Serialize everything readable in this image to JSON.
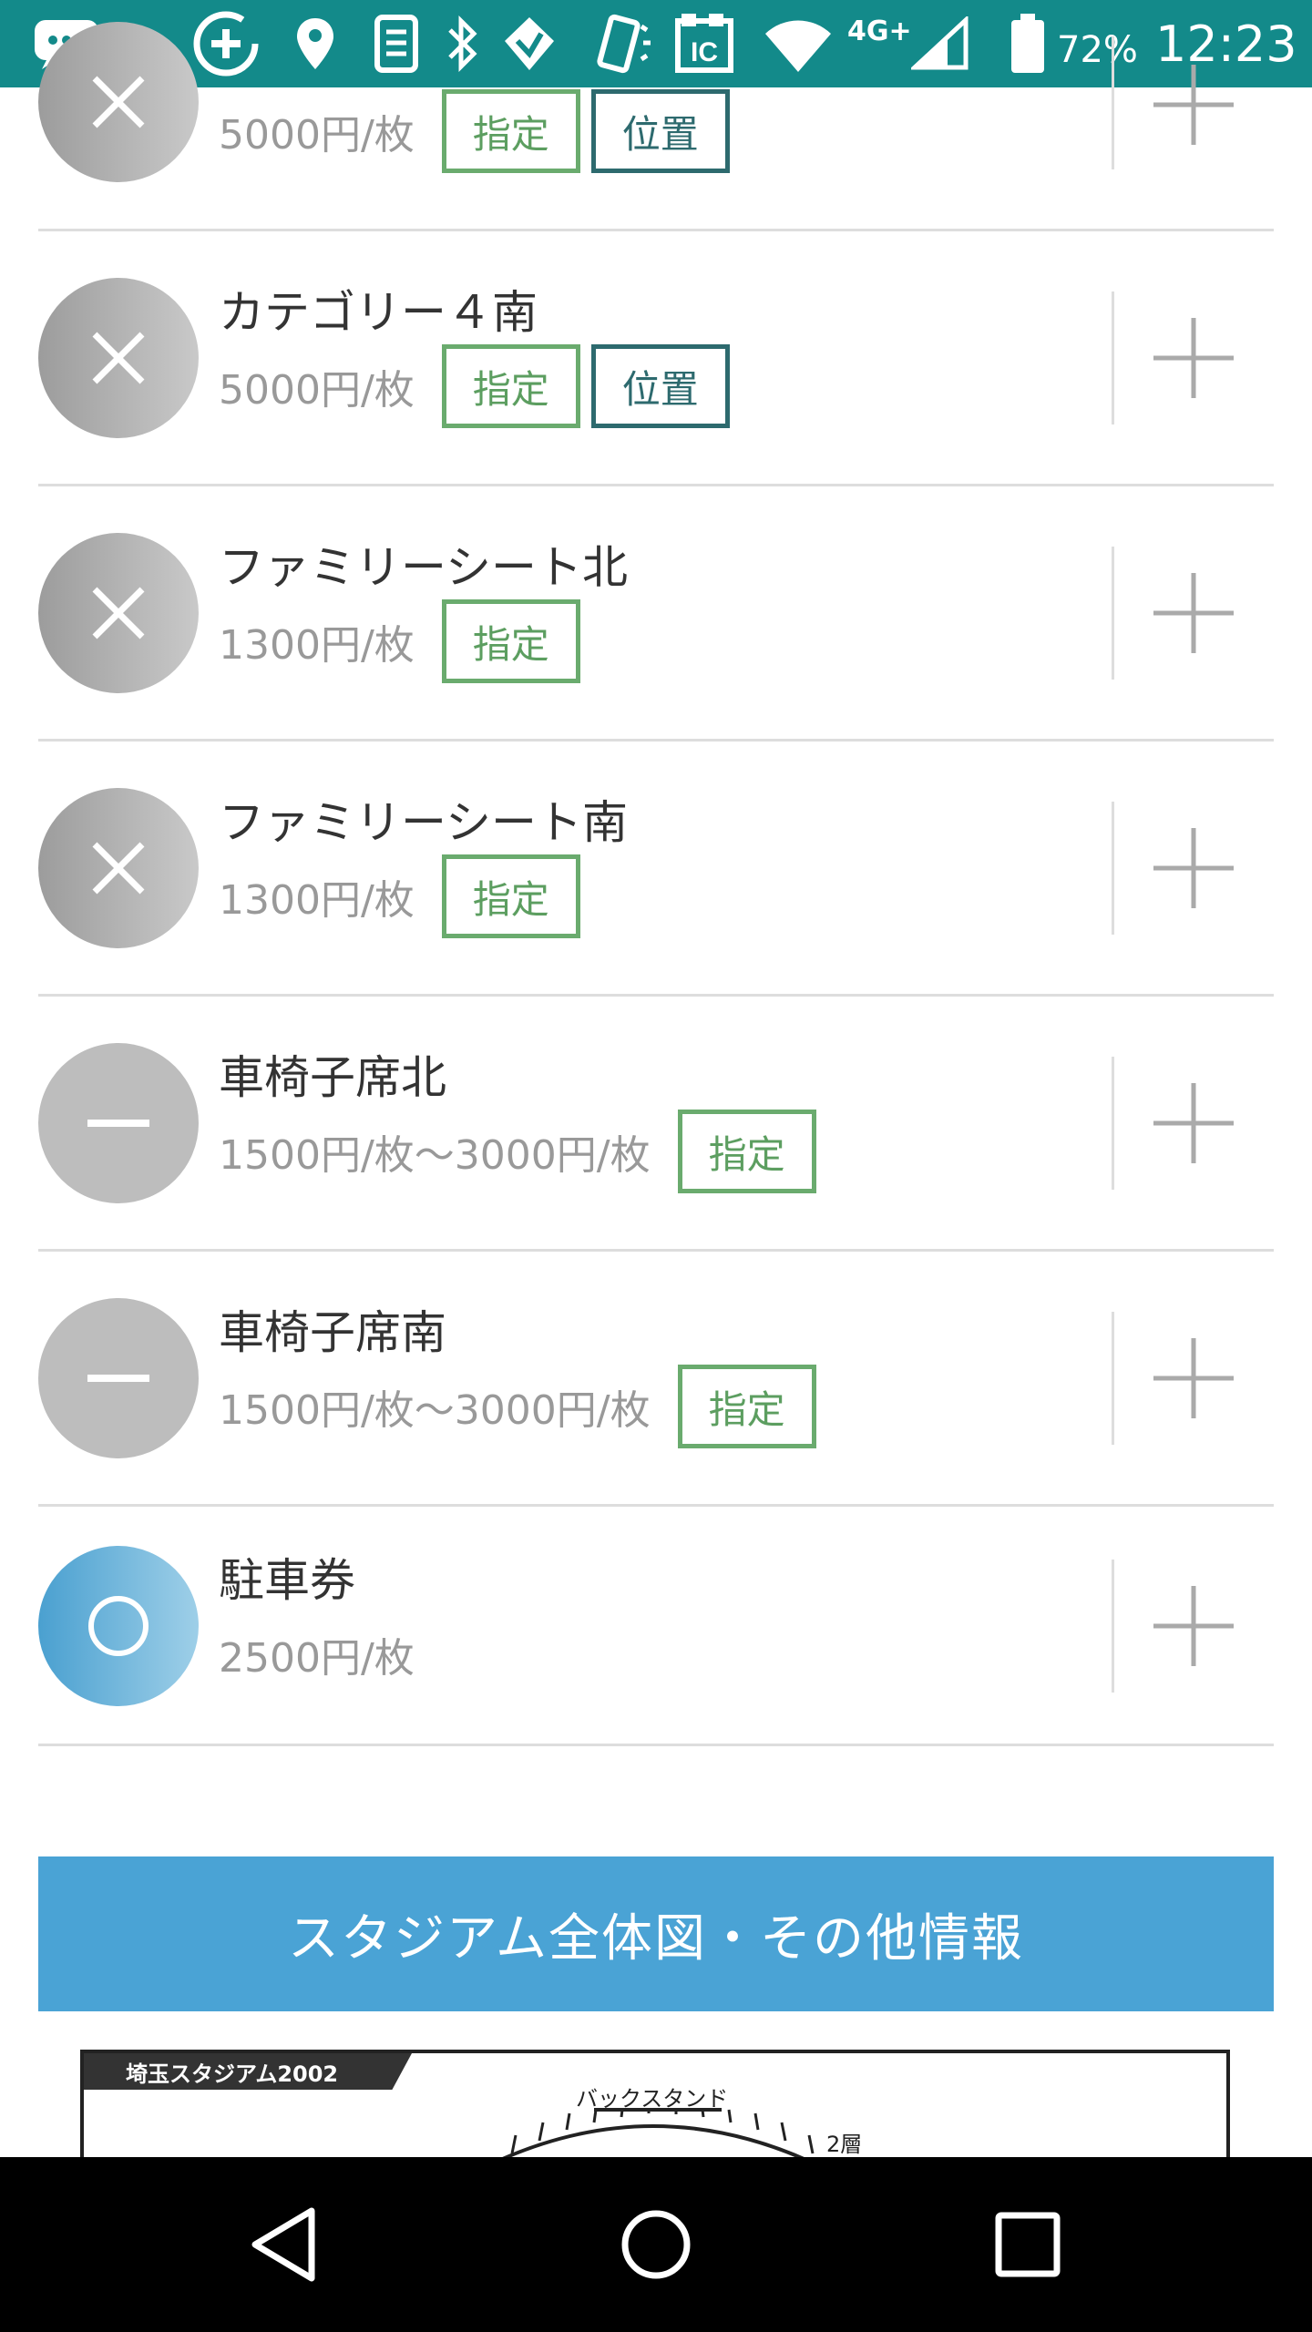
{
  "status_bar": {
    "network_type": "4G+",
    "battery_percent": "72%",
    "time": "12:23",
    "icons": [
      "chat-notification-icon",
      "data-saver-icon",
      "location-icon",
      "sim-icon",
      "bluetooth-icon",
      "shield-icon",
      "vibrate-icon",
      "ic-card-icon",
      "wifi-icon",
      "cellular-signal-icon",
      "battery-icon"
    ]
  },
  "tickets": [
    {
      "name": "",
      "price": "5000円/枚",
      "tags": [
        "指定",
        "位置"
      ],
      "status": "soldout",
      "status_icon": "close-icon"
    },
    {
      "name": "カテゴリー４南",
      "price": "5000円/枚",
      "tags": [
        "指定",
        "位置"
      ],
      "status": "soldout",
      "status_icon": "close-icon"
    },
    {
      "name": "ファミリーシート北",
      "price": "1300円/枚",
      "tags": [
        "指定"
      ],
      "status": "soldout",
      "status_icon": "close-icon"
    },
    {
      "name": "ファミリーシート南",
      "price": "1300円/枚",
      "tags": [
        "指定"
      ],
      "status": "soldout",
      "status_icon": "close-icon"
    },
    {
      "name": "車椅子席北",
      "price": "1500円/枚～3000円/枚",
      "tags": [
        "指定"
      ],
      "status": "unavailable",
      "status_icon": "minus-icon"
    },
    {
      "name": "車椅子席南",
      "price": "1500円/枚～3000円/枚",
      "tags": [
        "指定"
      ],
      "status": "unavailable",
      "status_icon": "minus-icon"
    },
    {
      "name": "駐車券",
      "price": "2500円/枚",
      "tags": [],
      "status": "available",
      "status_icon": "circle-icon"
    }
  ],
  "tag_labels": {
    "reserved": "指定",
    "position": "位置"
  },
  "banner": {
    "label": "スタジアム全体図・その他情報"
  },
  "stadium_map": {
    "title": "埼玉スタジアム2002",
    "back_stand_label": "バックスタンド",
    "tier_label": "2層"
  },
  "nav_bar": {
    "buttons": [
      "back-icon",
      "home-icon",
      "recents-icon"
    ]
  },
  "colors": {
    "status_bar": "#138a8a",
    "reserved_tag": "#6aab6e",
    "position_tag": "#2d6a6e",
    "banner": "#4aa3d5",
    "available": "#4aa0d0"
  }
}
